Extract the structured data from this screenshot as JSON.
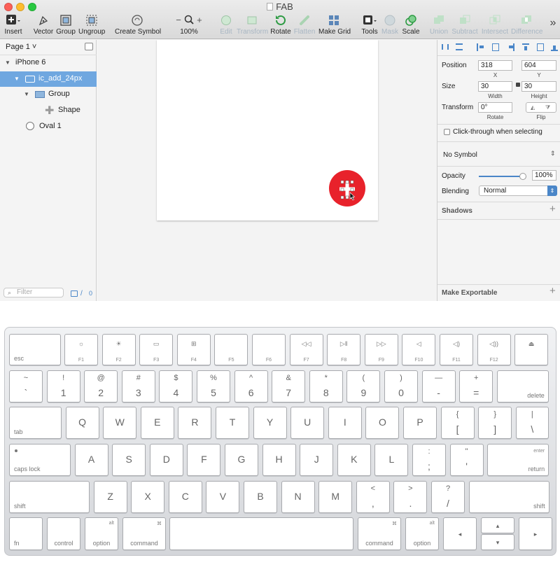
{
  "window": {
    "title": "FAB"
  },
  "toolbar": {
    "insert": "Insert",
    "vector": "Vector",
    "group": "Group",
    "ungroup": "Ungroup",
    "create_symbol": "Create Symbol",
    "zoom_value": "100%",
    "edit": "Edit",
    "transform": "Transform",
    "rotate": "Rotate",
    "flatten": "Flatten",
    "make_grid": "Make Grid",
    "tools": "Tools",
    "mask": "Mask",
    "scale": "Scale",
    "union": "Union",
    "subtract": "Subtract",
    "intersect": "Intersect",
    "difference": "Difference",
    "zoom_minus": "−",
    "zoom_plus": "+",
    "overflow": "»"
  },
  "sidebar": {
    "page": "Page 1 ˅",
    "layers": [
      {
        "label": "iPhone 6"
      },
      {
        "label": "ic_add_24px"
      },
      {
        "label": "Group"
      },
      {
        "label": "Shape"
      },
      {
        "label": "Oval 1"
      }
    ],
    "filter_placeholder": "Filter",
    "count": "0"
  },
  "inspector": {
    "position_label": "Position",
    "x": "318",
    "y": "604",
    "x_label": "X",
    "y_label": "Y",
    "size_label": "Size",
    "width": "30",
    "height": "30",
    "width_label": "Width",
    "height_label": "Height",
    "transform_label": "Transform",
    "rotate": "0°",
    "rotate_label": "Rotate",
    "flip_label": "Flip",
    "click_through": "Click-through when selecting",
    "symbol": "No Symbol",
    "opacity_label": "Opacity",
    "opacity": "100%",
    "opacity_fraction": 1.0,
    "blending_label": "Blending",
    "blending": "Normal",
    "shadows": "Shadows",
    "make_exportable": "Make Exportable"
  },
  "colors": {
    "fab": "#e8222b",
    "selection": "#6fa7e0"
  },
  "keyboard": {
    "fn_row": [
      {
        "label": "esc"
      },
      {
        "icon": "☼",
        "label": "F1"
      },
      {
        "icon": "☀",
        "label": "F2"
      },
      {
        "icon": "▭",
        "label": "F3"
      },
      {
        "icon": "⊞",
        "label": "F4"
      },
      {
        "icon": "",
        "label": "F5"
      },
      {
        "icon": "",
        "label": "F6"
      },
      {
        "icon": "◁◁",
        "label": "F7"
      },
      {
        "icon": "▷‖",
        "label": "F8"
      },
      {
        "icon": "▷▷",
        "label": "F9"
      },
      {
        "icon": "◁",
        "label": "F10"
      },
      {
        "icon": "◁)",
        "label": "F11"
      },
      {
        "icon": "◁))",
        "label": "F12"
      },
      {
        "icon": "⏏",
        "label": ""
      }
    ],
    "num_row": [
      {
        "up": "~",
        "dn": "`"
      },
      {
        "up": "!",
        "dn": "1"
      },
      {
        "up": "@",
        "dn": "2"
      },
      {
        "up": "#",
        "dn": "3"
      },
      {
        "up": "$",
        "dn": "4"
      },
      {
        "up": "%",
        "dn": "5"
      },
      {
        "up": "^",
        "dn": "6"
      },
      {
        "up": "&",
        "dn": "7"
      },
      {
        "up": "*",
        "dn": "8"
      },
      {
        "up": "(",
        "dn": "9"
      },
      {
        "up": ")",
        "dn": "0"
      },
      {
        "up": "—",
        "dn": "-"
      },
      {
        "up": "+",
        "dn": "="
      },
      {
        "label": "delete"
      }
    ],
    "q_row": [
      {
        "label": "tab"
      },
      {
        "c": "Q"
      },
      {
        "c": "W"
      },
      {
        "c": "E"
      },
      {
        "c": "R"
      },
      {
        "c": "T"
      },
      {
        "c": "Y"
      },
      {
        "c": "U"
      },
      {
        "c": "I"
      },
      {
        "c": "O"
      },
      {
        "c": "P"
      },
      {
        "up": "{",
        "dn": "["
      },
      {
        "up": "}",
        "dn": "]"
      },
      {
        "up": "|",
        "dn": "\\"
      }
    ],
    "a_row": [
      {
        "label": "caps lock"
      },
      {
        "c": "A"
      },
      {
        "c": "S"
      },
      {
        "c": "D"
      },
      {
        "c": "F"
      },
      {
        "c": "G"
      },
      {
        "c": "H"
      },
      {
        "c": "J"
      },
      {
        "c": "K"
      },
      {
        "c": "L"
      },
      {
        "up": ":",
        "dn": ";"
      },
      {
        "up": "\"",
        "dn": "'"
      },
      {
        "label": "return",
        "top": "enter"
      }
    ],
    "z_row": [
      {
        "label": "shift"
      },
      {
        "c": "Z"
      },
      {
        "c": "X"
      },
      {
        "c": "C"
      },
      {
        "c": "V"
      },
      {
        "c": "B"
      },
      {
        "c": "N"
      },
      {
        "c": "M"
      },
      {
        "up": "<",
        "dn": ","
      },
      {
        "up": ">",
        "dn": "."
      },
      {
        "up": "?",
        "dn": "/"
      },
      {
        "label": "shift"
      }
    ],
    "bottom_row": [
      {
        "label": "fn"
      },
      {
        "label": "control"
      },
      {
        "label": "option",
        "top": "alt"
      },
      {
        "label": "command",
        "top": "⌘"
      },
      {
        "label": ""
      },
      {
        "label": "command",
        "top": "⌘"
      },
      {
        "label": "option",
        "top": "alt"
      },
      {
        "label": "◂"
      },
      {
        "label": "▴"
      },
      {
        "label": "▾"
      },
      {
        "label": "▸"
      }
    ]
  }
}
